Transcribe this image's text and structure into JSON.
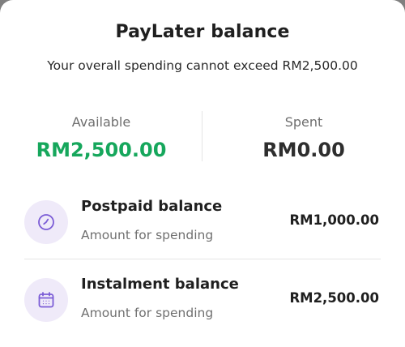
{
  "sheet": {
    "title": "PayLater balance",
    "subtitle": "Your overall spending cannot exceed RM2,500.00"
  },
  "summary": {
    "available_label": "Available",
    "available_value": "RM2,500.00",
    "spent_label": "Spent",
    "spent_value": "RM0.00"
  },
  "balances": [
    {
      "icon": "clock-icon",
      "title": "Postpaid balance",
      "subtitle": "Amount for spending",
      "amount": "RM1,000.00"
    },
    {
      "icon": "calendar-icon",
      "title": "Instalment balance",
      "subtitle": "Amount for spending",
      "amount": "RM2,500.00"
    }
  ],
  "colors": {
    "available": "#16a75c",
    "icon_accent": "#7b5cd6",
    "icon_bg": "#efeaf9"
  }
}
